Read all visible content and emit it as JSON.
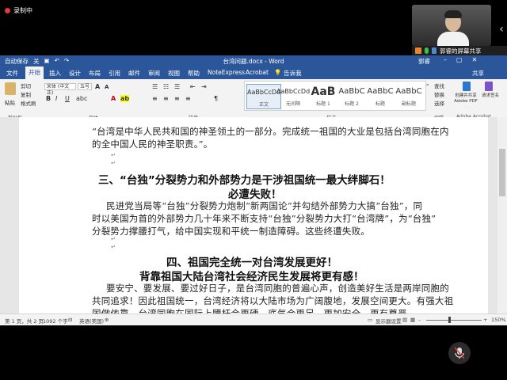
{
  "screen_share": {
    "recording_label": "录制中",
    "presenter_label": "郭睿的屏幕共享"
  },
  "window": {
    "title": "台湾问题.docx - Word",
    "user": "郭睿",
    "quick_access": [
      "自动保存",
      "关"
    ]
  },
  "tabs": {
    "items": [
      "文件",
      "开始",
      "插入",
      "设计",
      "布局",
      "引用",
      "邮件",
      "审阅",
      "视图",
      "帮助",
      "NoteExpress",
      "Acrobat"
    ],
    "active": "开始",
    "tell_me": "告诉我",
    "share": "共享"
  },
  "ribbon": {
    "clipboard": {
      "paste": "粘贴",
      "cut": "剪切",
      "copy": "复制",
      "format_painter": "格式刷",
      "group_label": "剪贴板"
    },
    "font": {
      "font_name": "宋体 (中文正)",
      "font_size": "五号",
      "bold": "B",
      "italic": "I",
      "underline": "U",
      "group_label": "字体"
    },
    "paragraph": {
      "group_label": "段落"
    },
    "styles": {
      "items": [
        {
          "sample": "AaBbCcDd",
          "name": "正文"
        },
        {
          "sample": "AaBbCcDd",
          "name": "无间隔"
        },
        {
          "sample": "AaB",
          "name": "标题 1"
        },
        {
          "sample": "AaBbC",
          "name": "标题 2"
        },
        {
          "sample": "AaBbC",
          "name": "标题"
        },
        {
          "sample": "AaBbC",
          "name": "副标题"
        }
      ],
      "group_label": "样式"
    },
    "editing": {
      "find": "查找",
      "replace": "替换",
      "select": "选择",
      "group_label": "编辑"
    },
    "acrobat": {
      "create_share": "创建并共享 Adobe PDF",
      "request_sign": "请求签名",
      "group_label": "Adobe Acrobat"
    }
  },
  "document": {
    "lines_top": [
      "“台湾是中华人民共和国的神圣领土的一部分。完成统一祖国的大业是包括台湾同胞在内",
      "的全中国人民的神圣职责。”。"
    ],
    "heading3": [
      "三、“台独”分裂势力和外部势力是干涉祖国统一最大绊脚石！",
      "必遭失败！"
    ],
    "para3": [
      "民进党当局等“台独”分裂势力炮制“新两国论”并勾结外部势力大搞“台独”，同",
      "时以美国为首的外部势力几十年来不断支持“台独”分裂势力大打“台湾牌”，为“台独”",
      "分裂势力撑腰打气，给中国实现和平统一制造障碍。这些终遭失败。"
    ],
    "heading4": [
      "四、祖国完全统一对台湾发展更好！",
      "背靠祖国大陆台湾社会经济民生发展将更有感！"
    ],
    "para4": [
      "要安宁、要发展、要过好日子，是台湾同胞的普遍心声，创造美好生活是两岸同胞的",
      "共同追求！因此祖国统一，台湾经济将以大陆市场为广阔腹地，发展空间更大。有强大祖",
      "国做依靠，台湾同胞在国际上腰杆会更硬、底气会更足，更加安全、更有尊严。"
    ]
  },
  "status_bar": {
    "page": "第 1 页，共 2 页",
    "words": "1092 个字",
    "language": "英语(美国)",
    "display_settings": "显示器设置",
    "zoom": "150%"
  }
}
